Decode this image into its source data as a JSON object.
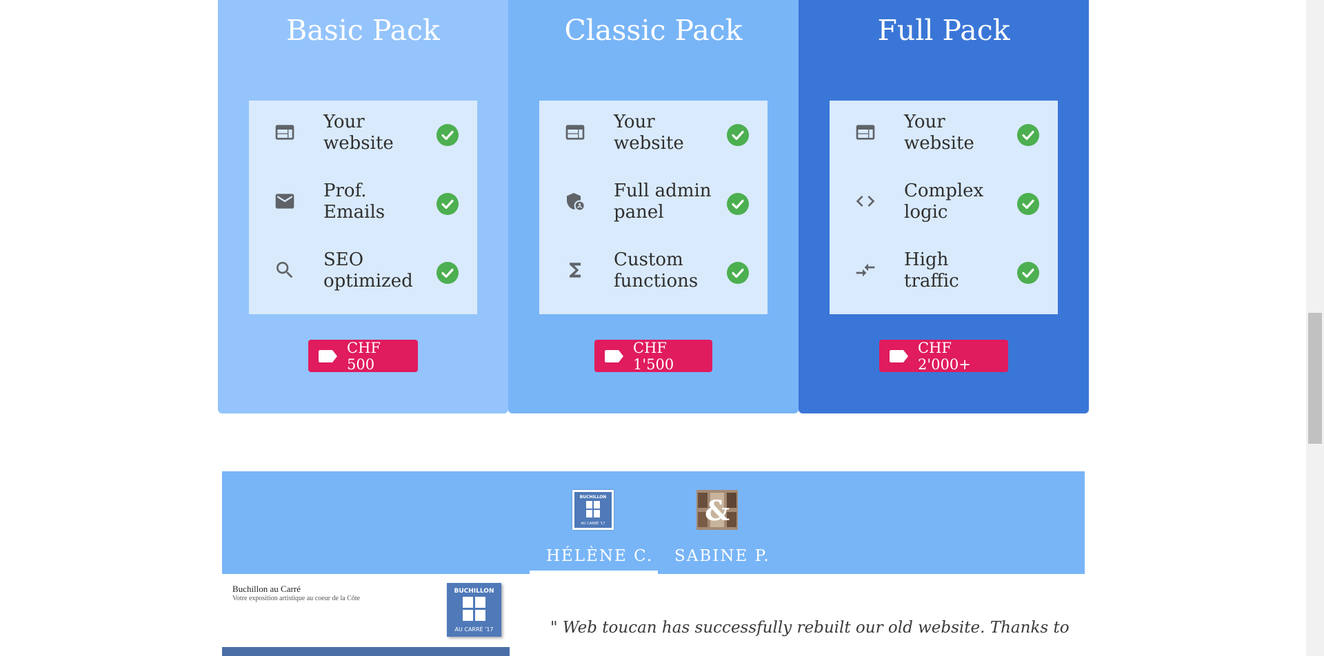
{
  "pricing": {
    "cards": [
      {
        "title": "Basic Pack",
        "bg": "#94c4fb",
        "features": [
          {
            "icon": "web-icon",
            "label": "Your website"
          },
          {
            "icon": "mail-icon",
            "label": "Prof. Emails"
          },
          {
            "icon": "search-icon",
            "label": "SEO optimized"
          }
        ],
        "price": "CHF 500"
      },
      {
        "title": "Classic Pack",
        "bg": "#78b5f7",
        "features": [
          {
            "icon": "web-icon",
            "label": "Your website"
          },
          {
            "icon": "admin-shield-icon",
            "label": "Full admin panel"
          },
          {
            "icon": "sigma-icon",
            "label": "Custom functions"
          }
        ],
        "price": "CHF 1'500"
      },
      {
        "title": "Full Pack",
        "bg": "#3a76d7",
        "features": [
          {
            "icon": "web-icon",
            "label": "Your website"
          },
          {
            "icon": "code-icon",
            "label": "Complex logic"
          },
          {
            "icon": "compare-arrows-icon",
            "label": "High traffic"
          }
        ],
        "price": "CHF 2'000+"
      }
    ],
    "colors": {
      "feature_box": "#d9eafc",
      "check": "#4caf50",
      "price_button": "#e01b5e"
    }
  },
  "testimonials": {
    "bar_color": "#78b5f7",
    "tabs": [
      {
        "name": "HÉLÈNE C.",
        "active": true,
        "avatar": "buchillon-logo"
      },
      {
        "name": "SABINE P.",
        "active": false,
        "avatar": "ampersand-photo"
      }
    ],
    "avatar_logo_text_top": "BUCHILLON",
    "avatar_logo_text_bottom": "AU CARRÉ '17",
    "preview": {
      "site_title": "Buchillon au Carré",
      "site_subtitle": "Votre exposition artistique au coeur de la Côte",
      "logo_top": "BUCHILLON",
      "logo_bottom": "AU CARRÉ '17"
    },
    "quote": "\" Web toucan has successfully rebuilt our old website. Thanks to"
  }
}
